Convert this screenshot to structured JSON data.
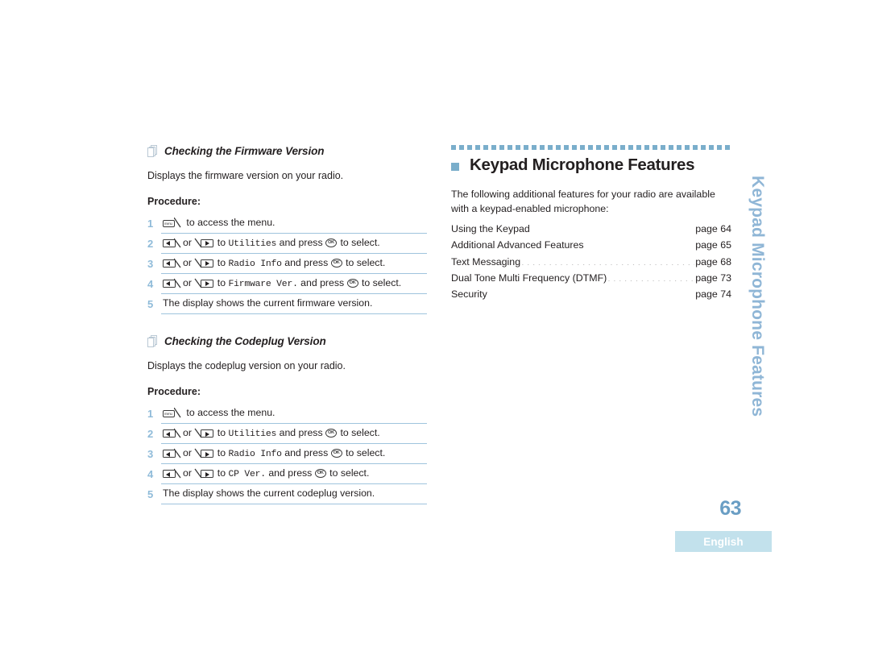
{
  "page": {
    "number": "63",
    "language_badge": "English",
    "side_tab": "Keypad Microphone Features"
  },
  "left_column": {
    "sections": [
      {
        "icon": "stacked-pages-icon",
        "title": "Checking the Firmware Version",
        "description": "Displays the firmware version on your radio.",
        "procedure_label": "Procedure:",
        "steps": [
          {
            "number": "1",
            "parts": [
              {
                "type": "key",
                "icon": "menu-key-icon",
                "label": "menu"
              },
              {
                "type": "text",
                "text": " to access the menu."
              }
            ]
          },
          {
            "number": "2",
            "parts": [
              {
                "type": "key",
                "icon": "left-arrow-key-icon"
              },
              {
                "type": "text",
                "text": "or "
              },
              {
                "type": "key",
                "icon": "right-arrow-key-icon"
              },
              {
                "type": "text",
                "text": " to "
              },
              {
                "type": "mono",
                "text": "Utilities"
              },
              {
                "type": "text",
                "text": " and press "
              },
              {
                "type": "key",
                "icon": "ok-key-icon",
                "label": "OK"
              },
              {
                "type": "text",
                "text": " to select."
              }
            ]
          },
          {
            "number": "3",
            "parts": [
              {
                "type": "key",
                "icon": "left-arrow-key-icon"
              },
              {
                "type": "text",
                "text": "or "
              },
              {
                "type": "key",
                "icon": "right-arrow-key-icon"
              },
              {
                "type": "text",
                "text": " to "
              },
              {
                "type": "mono",
                "text": "Radio Info"
              },
              {
                "type": "text",
                "text": " and press "
              },
              {
                "type": "key",
                "icon": "ok-key-icon",
                "label": "OK"
              },
              {
                "type": "text",
                "text": " to select."
              }
            ]
          },
          {
            "number": "4",
            "parts": [
              {
                "type": "key",
                "icon": "left-arrow-key-icon"
              },
              {
                "type": "text",
                "text": "or "
              },
              {
                "type": "key",
                "icon": "right-arrow-key-icon"
              },
              {
                "type": "text",
                "text": " to "
              },
              {
                "type": "mono",
                "text": "Firmware Ver."
              },
              {
                "type": "text",
                "text": " and press "
              },
              {
                "type": "key",
                "icon": "ok-key-icon",
                "label": "OK"
              },
              {
                "type": "text",
                "text": " to select."
              }
            ]
          },
          {
            "number": "5",
            "parts": [
              {
                "type": "text",
                "text": "The display shows the current firmware version."
              }
            ]
          }
        ]
      },
      {
        "icon": "stacked-pages-icon",
        "title": "Checking the Codeplug Version",
        "description": "Displays the codeplug version on your radio.",
        "procedure_label": "Procedure:",
        "steps": [
          {
            "number": "1",
            "parts": [
              {
                "type": "key",
                "icon": "menu-key-icon",
                "label": "menu"
              },
              {
                "type": "text",
                "text": " to access the menu."
              }
            ]
          },
          {
            "number": "2",
            "parts": [
              {
                "type": "key",
                "icon": "left-arrow-key-icon"
              },
              {
                "type": "text",
                "text": "or "
              },
              {
                "type": "key",
                "icon": "right-arrow-key-icon"
              },
              {
                "type": "text",
                "text": " to "
              },
              {
                "type": "mono",
                "text": "Utilities"
              },
              {
                "type": "text",
                "text": " and press "
              },
              {
                "type": "key",
                "icon": "ok-key-icon",
                "label": "OK"
              },
              {
                "type": "text",
                "text": " to select."
              }
            ]
          },
          {
            "number": "3",
            "parts": [
              {
                "type": "key",
                "icon": "left-arrow-key-icon"
              },
              {
                "type": "text",
                "text": "or "
              },
              {
                "type": "key",
                "icon": "right-arrow-key-icon"
              },
              {
                "type": "text",
                "text": " to "
              },
              {
                "type": "mono",
                "text": "Radio Info"
              },
              {
                "type": "text",
                "text": " and press "
              },
              {
                "type": "key",
                "icon": "ok-key-icon",
                "label": "OK"
              },
              {
                "type": "text",
                "text": " to select."
              }
            ]
          },
          {
            "number": "4",
            "parts": [
              {
                "type": "key",
                "icon": "left-arrow-key-icon"
              },
              {
                "type": "text",
                "text": "or "
              },
              {
                "type": "key",
                "icon": "right-arrow-key-icon"
              },
              {
                "type": "text",
                "text": " to "
              },
              {
                "type": "mono",
                "text": "CP Ver."
              },
              {
                "type": "text",
                "text": " and press "
              },
              {
                "type": "key",
                "icon": "ok-key-icon",
                "label": "OK"
              },
              {
                "type": "text",
                "text": " to select."
              }
            ]
          },
          {
            "number": "5",
            "parts": [
              {
                "type": "text",
                "text": "The display shows the current codeplug version."
              }
            ]
          }
        ]
      }
    ]
  },
  "right_column": {
    "heading": "Keypad Microphone Features",
    "intro": "The following additional features for your radio are available with a keypad-enabled microphone:",
    "toc": [
      {
        "title": "Using the Keypad",
        "page": "page 64"
      },
      {
        "title": "Additional Advanced Features",
        "page": "page 65"
      },
      {
        "title": "Text Messaging",
        "page": "page 68"
      },
      {
        "title": "Dual Tone Multi Frequency (DTMF)",
        "page": "page 73"
      },
      {
        "title": "Security",
        "page": "page 74"
      }
    ]
  },
  "colors": {
    "accent_blue": "#7aaecb",
    "light_blue": "#8fbbd9",
    "rule_blue": "#9fc4dd",
    "badge_bg": "#c2e1ec",
    "page_number": "#6a9ec4",
    "text": "#231f20"
  }
}
